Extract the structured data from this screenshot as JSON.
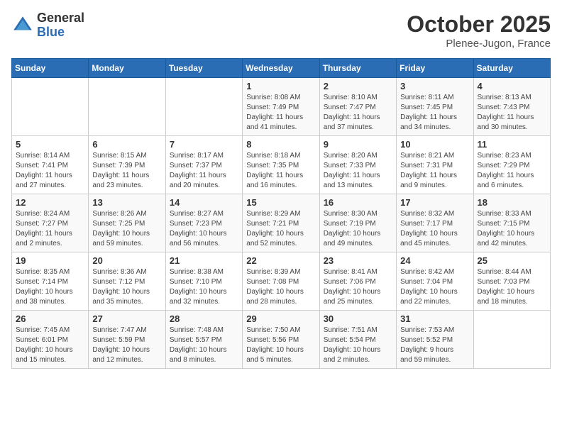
{
  "header": {
    "logo_general": "General",
    "logo_blue": "Blue",
    "month_title": "October 2025",
    "location": "Plenee-Jugon, France"
  },
  "days_of_week": [
    "Sunday",
    "Monday",
    "Tuesday",
    "Wednesday",
    "Thursday",
    "Friday",
    "Saturday"
  ],
  "weeks": [
    [
      {
        "day": "",
        "info": ""
      },
      {
        "day": "",
        "info": ""
      },
      {
        "day": "",
        "info": ""
      },
      {
        "day": "1",
        "info": "Sunrise: 8:08 AM\nSunset: 7:49 PM\nDaylight: 11 hours\nand 41 minutes."
      },
      {
        "day": "2",
        "info": "Sunrise: 8:10 AM\nSunset: 7:47 PM\nDaylight: 11 hours\nand 37 minutes."
      },
      {
        "day": "3",
        "info": "Sunrise: 8:11 AM\nSunset: 7:45 PM\nDaylight: 11 hours\nand 34 minutes."
      },
      {
        "day": "4",
        "info": "Sunrise: 8:13 AM\nSunset: 7:43 PM\nDaylight: 11 hours\nand 30 minutes."
      }
    ],
    [
      {
        "day": "5",
        "info": "Sunrise: 8:14 AM\nSunset: 7:41 PM\nDaylight: 11 hours\nand 27 minutes."
      },
      {
        "day": "6",
        "info": "Sunrise: 8:15 AM\nSunset: 7:39 PM\nDaylight: 11 hours\nand 23 minutes."
      },
      {
        "day": "7",
        "info": "Sunrise: 8:17 AM\nSunset: 7:37 PM\nDaylight: 11 hours\nand 20 minutes."
      },
      {
        "day": "8",
        "info": "Sunrise: 8:18 AM\nSunset: 7:35 PM\nDaylight: 11 hours\nand 16 minutes."
      },
      {
        "day": "9",
        "info": "Sunrise: 8:20 AM\nSunset: 7:33 PM\nDaylight: 11 hours\nand 13 minutes."
      },
      {
        "day": "10",
        "info": "Sunrise: 8:21 AM\nSunset: 7:31 PM\nDaylight: 11 hours\nand 9 minutes."
      },
      {
        "day": "11",
        "info": "Sunrise: 8:23 AM\nSunset: 7:29 PM\nDaylight: 11 hours\nand 6 minutes."
      }
    ],
    [
      {
        "day": "12",
        "info": "Sunrise: 8:24 AM\nSunset: 7:27 PM\nDaylight: 11 hours\nand 2 minutes."
      },
      {
        "day": "13",
        "info": "Sunrise: 8:26 AM\nSunset: 7:25 PM\nDaylight: 10 hours\nand 59 minutes."
      },
      {
        "day": "14",
        "info": "Sunrise: 8:27 AM\nSunset: 7:23 PM\nDaylight: 10 hours\nand 56 minutes."
      },
      {
        "day": "15",
        "info": "Sunrise: 8:29 AM\nSunset: 7:21 PM\nDaylight: 10 hours\nand 52 minutes."
      },
      {
        "day": "16",
        "info": "Sunrise: 8:30 AM\nSunset: 7:19 PM\nDaylight: 10 hours\nand 49 minutes."
      },
      {
        "day": "17",
        "info": "Sunrise: 8:32 AM\nSunset: 7:17 PM\nDaylight: 10 hours\nand 45 minutes."
      },
      {
        "day": "18",
        "info": "Sunrise: 8:33 AM\nSunset: 7:15 PM\nDaylight: 10 hours\nand 42 minutes."
      }
    ],
    [
      {
        "day": "19",
        "info": "Sunrise: 8:35 AM\nSunset: 7:14 PM\nDaylight: 10 hours\nand 38 minutes."
      },
      {
        "day": "20",
        "info": "Sunrise: 8:36 AM\nSunset: 7:12 PM\nDaylight: 10 hours\nand 35 minutes."
      },
      {
        "day": "21",
        "info": "Sunrise: 8:38 AM\nSunset: 7:10 PM\nDaylight: 10 hours\nand 32 minutes."
      },
      {
        "day": "22",
        "info": "Sunrise: 8:39 AM\nSunset: 7:08 PM\nDaylight: 10 hours\nand 28 minutes."
      },
      {
        "day": "23",
        "info": "Sunrise: 8:41 AM\nSunset: 7:06 PM\nDaylight: 10 hours\nand 25 minutes."
      },
      {
        "day": "24",
        "info": "Sunrise: 8:42 AM\nSunset: 7:04 PM\nDaylight: 10 hours\nand 22 minutes."
      },
      {
        "day": "25",
        "info": "Sunrise: 8:44 AM\nSunset: 7:03 PM\nDaylight: 10 hours\nand 18 minutes."
      }
    ],
    [
      {
        "day": "26",
        "info": "Sunrise: 7:45 AM\nSunset: 6:01 PM\nDaylight: 10 hours\nand 15 minutes."
      },
      {
        "day": "27",
        "info": "Sunrise: 7:47 AM\nSunset: 5:59 PM\nDaylight: 10 hours\nand 12 minutes."
      },
      {
        "day": "28",
        "info": "Sunrise: 7:48 AM\nSunset: 5:57 PM\nDaylight: 10 hours\nand 8 minutes."
      },
      {
        "day": "29",
        "info": "Sunrise: 7:50 AM\nSunset: 5:56 PM\nDaylight: 10 hours\nand 5 minutes."
      },
      {
        "day": "30",
        "info": "Sunrise: 7:51 AM\nSunset: 5:54 PM\nDaylight: 10 hours\nand 2 minutes."
      },
      {
        "day": "31",
        "info": "Sunrise: 7:53 AM\nSunset: 5:52 PM\nDaylight: 9 hours\nand 59 minutes."
      },
      {
        "day": "",
        "info": ""
      }
    ]
  ]
}
